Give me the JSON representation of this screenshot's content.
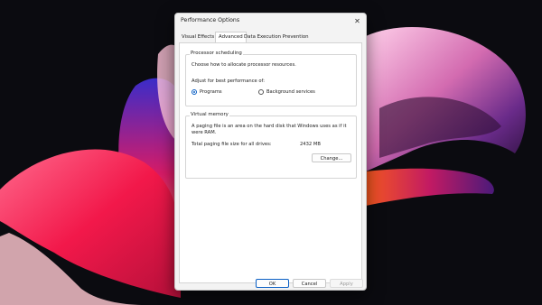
{
  "dialog": {
    "title": "Performance Options",
    "close_glyph": "✕"
  },
  "tabs": [
    {
      "label": "Visual Effects"
    },
    {
      "label": "Advanced"
    },
    {
      "label": "Data Execution Prevention"
    }
  ],
  "processor": {
    "title": "Processor scheduling",
    "description": "Choose how to allocate processor resources.",
    "adjust_label": "Adjust for best performance of:",
    "options": [
      {
        "label": "Programs",
        "checked": true
      },
      {
        "label": "Background services",
        "checked": false
      }
    ]
  },
  "virtual_memory": {
    "title": "Virtual memory",
    "description_line1": "A paging file is an area on the hard disk that Windows uses as if it",
    "description_line2": "were RAM.",
    "total_label": "Total paging file size for all drives:",
    "total_value": "2432 MB",
    "change_label": "Change..."
  },
  "footer": {
    "ok_label": "OK",
    "cancel_label": "Cancel",
    "apply_label": "Apply"
  },
  "colors": {
    "accent": "#0a5fc4",
    "wallpaper_background": "#0b0b10"
  }
}
